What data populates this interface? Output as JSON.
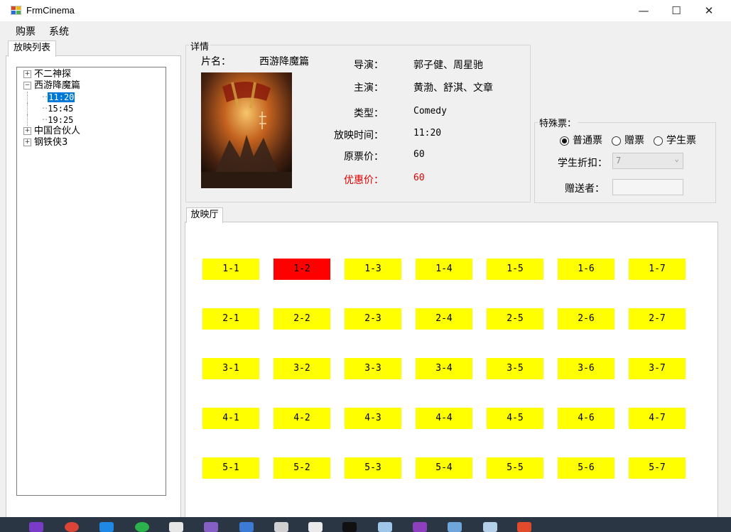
{
  "window": {
    "title": "FrmCinema",
    "minimize": "—",
    "maximize": "☐",
    "close": "✕"
  },
  "menu": {
    "items": [
      "购票",
      "系统"
    ]
  },
  "left": {
    "tab_label": "放映列表",
    "tree": [
      {
        "label": "不二神探",
        "toggle": "+"
      },
      {
        "label": "西游降魔篇",
        "toggle": "−",
        "times": [
          "11:20",
          "15:45",
          "19:25"
        ],
        "selected_time": "11:20"
      },
      {
        "label": "中国合伙人",
        "toggle": "+"
      },
      {
        "label": "钢铁侠3",
        "toggle": "+"
      }
    ]
  },
  "detail": {
    "group_title": "详情",
    "name_label": "片名：",
    "name_value": "西游降魔篇",
    "director_label": "导演：",
    "director_value": "郭子健、周星驰",
    "actor_label": "主演：",
    "actor_value": "黄渤、舒淇、文章",
    "type_label": "类型：",
    "type_value": "Comedy",
    "showtime_label": "放映时间：",
    "showtime_value": "11:20",
    "price_label": "原票价：",
    "price_value": "60",
    "discount_price_label": "优惠价：",
    "discount_price_value": "60",
    "discount_color": "#e00000",
    "poster_icon": "movie-poster-image"
  },
  "special": {
    "group_title": "特殊票：",
    "radio_normal": "普通票",
    "radio_gift": "赠票",
    "radio_student": "学生票",
    "selected": "普通票",
    "student_discount_label": "学生折扣：",
    "student_discount_value": "7",
    "giver_label": "赠送者：",
    "giver_value": ""
  },
  "hall": {
    "tab_label": "放映厅",
    "available_color": "#ffff00",
    "sold_color": "#ff0000",
    "rows": [
      [
        "1-1",
        "1-2",
        "1-3",
        "1-4",
        "1-5",
        "1-6",
        "1-7"
      ],
      [
        "2-1",
        "2-2",
        "2-3",
        "2-4",
        "2-5",
        "2-6",
        "2-7"
      ],
      [
        "3-1",
        "3-2",
        "3-3",
        "3-4",
        "3-5",
        "3-6",
        "3-7"
      ],
      [
        "4-1",
        "4-2",
        "4-3",
        "4-4",
        "4-5",
        "4-6",
        "4-7"
      ],
      [
        "5-1",
        "5-2",
        "5-3",
        "5-4",
        "5-5",
        "5-6",
        "5-7"
      ]
    ],
    "sold": [
      "1-2"
    ]
  }
}
